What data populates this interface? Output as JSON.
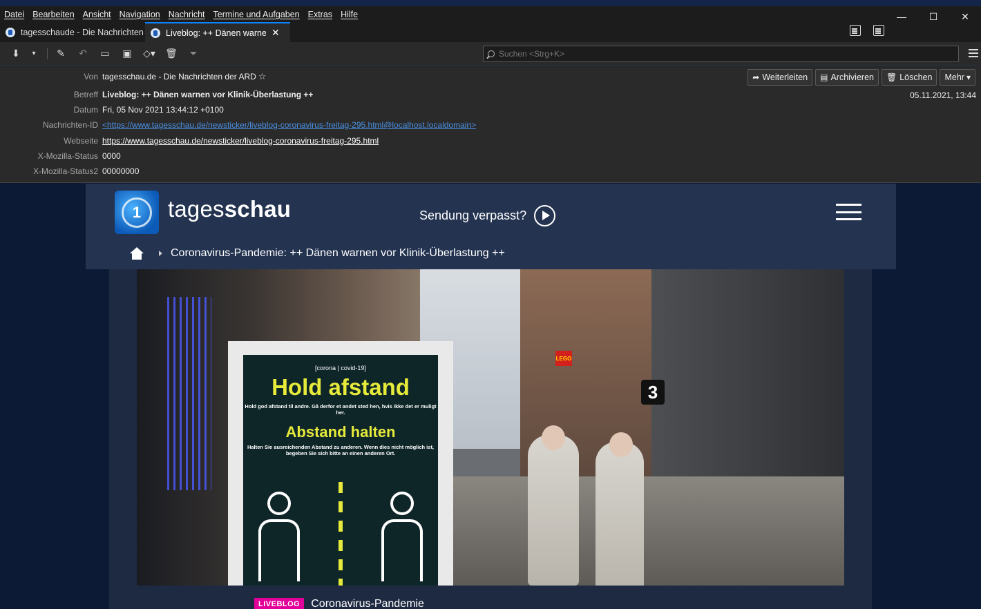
{
  "menubar": {
    "items": [
      "Datei",
      "Bearbeiten",
      "Ansicht",
      "Navigation",
      "Nachricht",
      "Termine und Aufgaben",
      "Extras",
      "Hilfe"
    ]
  },
  "window": {
    "minimize": "—",
    "maximize": "☐",
    "close": "✕"
  },
  "tabs": [
    {
      "label": "tagesschaude - Die Nachrichten",
      "active": false
    },
    {
      "label": "Liveblog: ++ Dänen warnen",
      "active": true
    }
  ],
  "search": {
    "placeholder": "Suchen <Strg+K>"
  },
  "message": {
    "from_label": "Von",
    "from": "tagesschau.de - Die Nachrichten der ARD",
    "subject_label": "Betreff",
    "subject": "Liveblog: ++ Dänen warnen vor Klinik-Überlastung ++",
    "date_label": "Datum",
    "date": "Fri, 05 Nov 2021 13:44:12 +0100",
    "msgid_label": "Nachrichten-ID",
    "msgid": "<https://www.tagesschau.de/newsticker/liveblog-coronavirus-freitag-295.html@localhost.localdomain>",
    "website_label": "Webseite",
    "website": "https://www.tagesschau.de/newsticker/liveblog-coronavirus-freitag-295.html",
    "status_label": "X-Mozilla-Status",
    "status": "0000",
    "status2_label": "X-Mozilla-Status2",
    "status2": "00000000",
    "received": "05.11.2021, 13:44"
  },
  "actions": {
    "forward": "Weiterleiten",
    "archive": "Archivieren",
    "delete": "Löschen",
    "more": "Mehr"
  },
  "site": {
    "brand_light": "tages",
    "brand_bold": "schau",
    "sendung": "Sendung verpasst?",
    "breadcrumb": "Coronavirus-Pandemie: ++ Dänen warnen vor Klinik-Überlastung ++",
    "sign": {
      "tag": "[corona | covid-19]",
      "h1": "Hold afstand",
      "p1": "Hold god afstand til andre. Gå derfor et andet sted hen, hvis ikke det er muligt her.",
      "h2": "Abstand halten",
      "p2": "Halten Sie ausreichenden Abstand zu anderen. Wenn dies nicht möglich ist, begeben Sie sich bitte an einen anderen Ort."
    },
    "badge": "LIVEBLOG",
    "kicker": "Coronavirus-Pandemie"
  }
}
